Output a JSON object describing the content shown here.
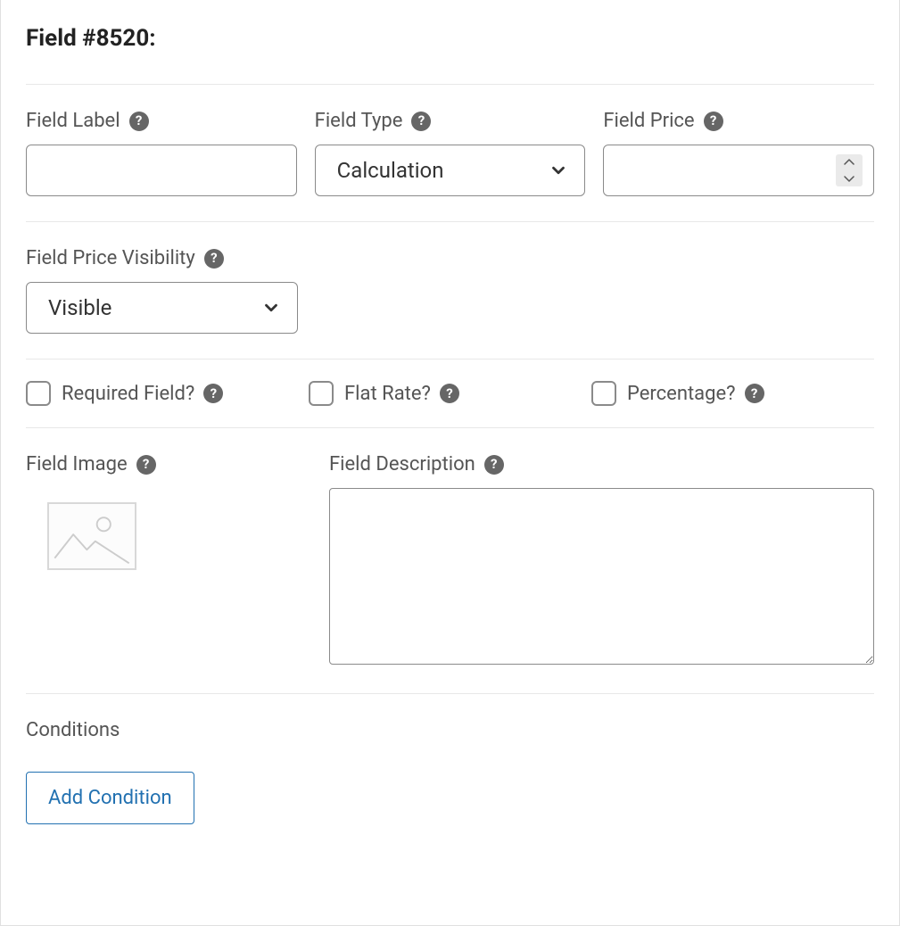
{
  "header": {
    "title": "Field #8520:"
  },
  "fields": {
    "label": {
      "label": "Field Label",
      "value": ""
    },
    "type": {
      "label": "Field Type",
      "value": "Calculation"
    },
    "price": {
      "label": "Field Price",
      "value": ""
    },
    "visibility": {
      "label": "Field Price Visibility",
      "value": "Visible"
    },
    "image": {
      "label": "Field Image"
    },
    "description": {
      "label": "Field Description",
      "value": ""
    }
  },
  "checkboxes": {
    "required": {
      "label": "Required Field?"
    },
    "flat_rate": {
      "label": "Flat Rate?"
    },
    "percentage": {
      "label": "Percentage?"
    }
  },
  "conditions": {
    "label": "Conditions",
    "add_button": "Add Condition"
  }
}
